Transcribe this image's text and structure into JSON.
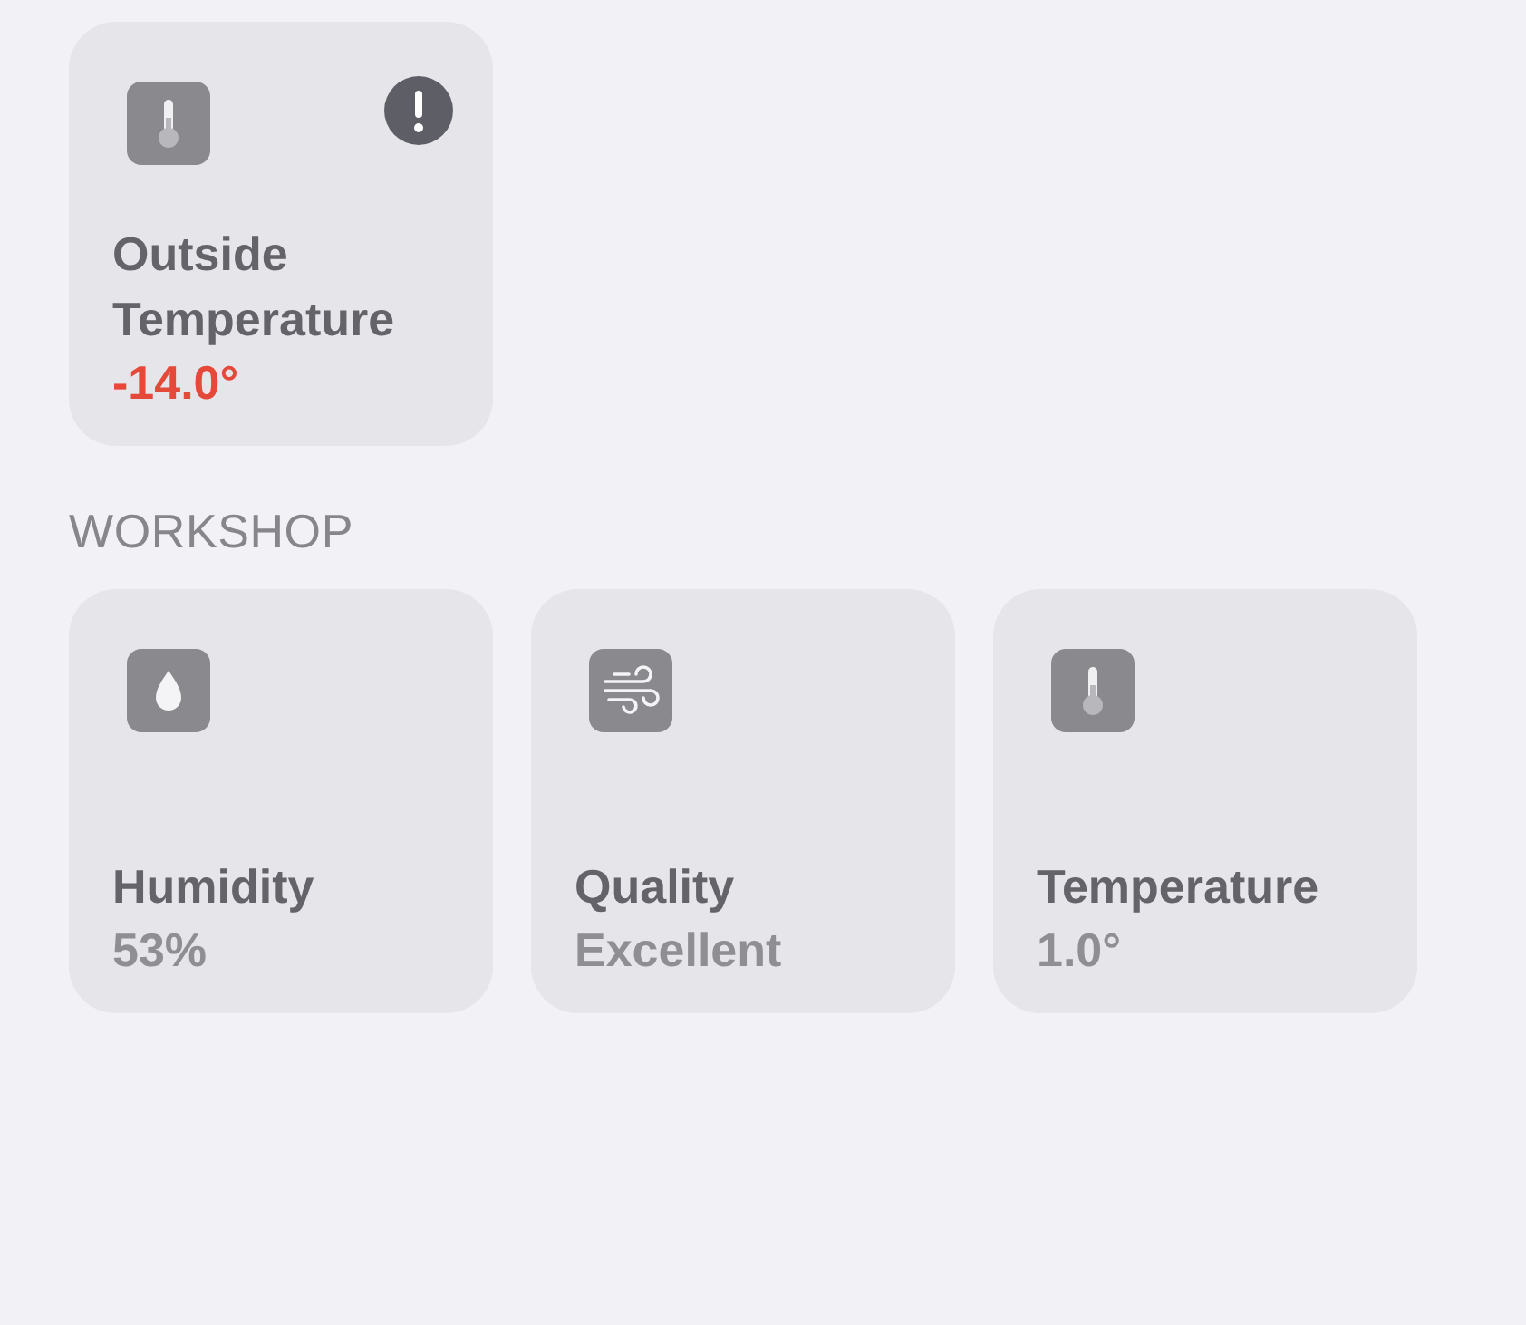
{
  "sections": [
    {
      "tiles": [
        {
          "kind": "thermometer",
          "name": "Outside Temperature",
          "value": "-14.0°",
          "alert": true
        }
      ]
    },
    {
      "title": "WORKSHOP",
      "tiles": [
        {
          "kind": "humidity",
          "name": "Humidity",
          "value": "53%",
          "alert": false
        },
        {
          "kind": "air",
          "name": "Quality",
          "value": "Excellent",
          "alert": false
        },
        {
          "kind": "thermometer",
          "name": "Temperature",
          "value": "1.0°",
          "alert": false
        }
      ]
    }
  ]
}
